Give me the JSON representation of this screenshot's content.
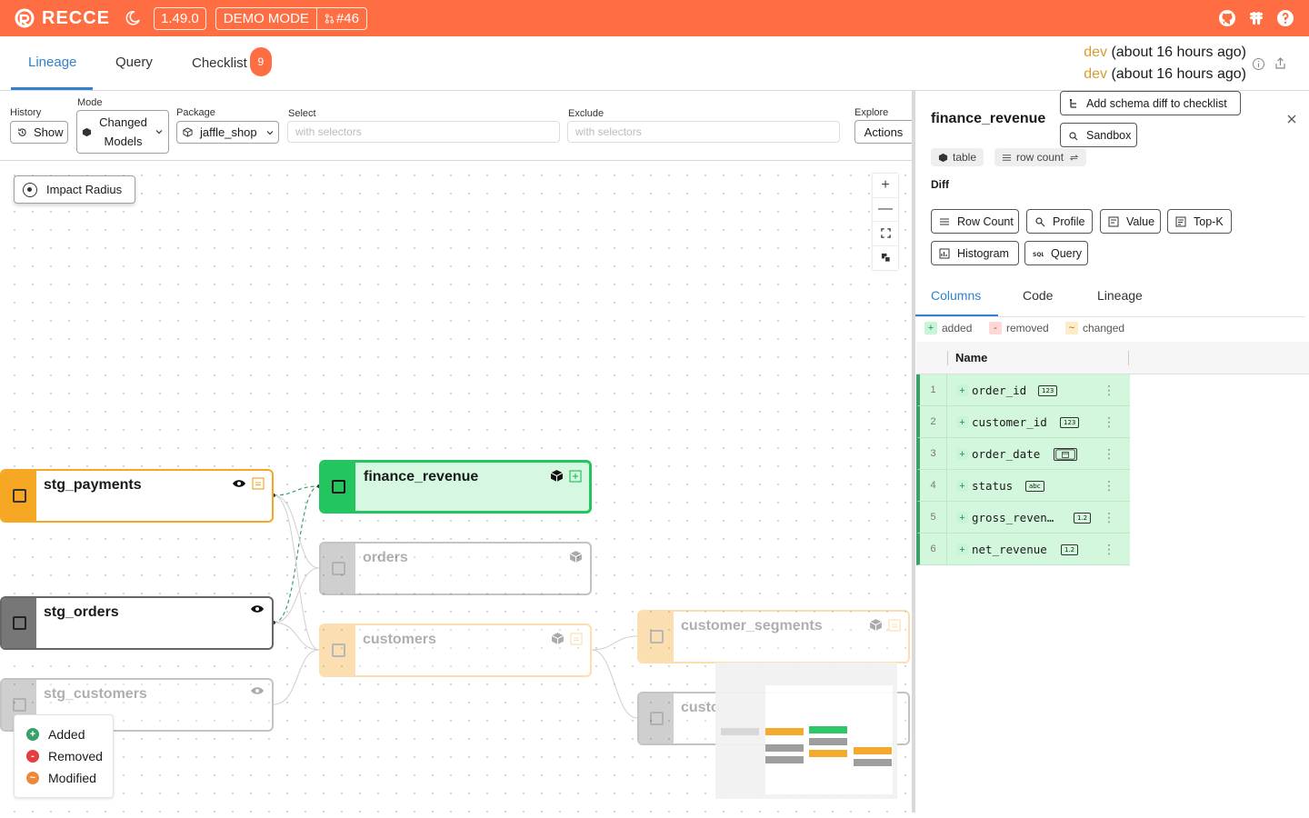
{
  "header": {
    "brand": "RECCE",
    "version": "1.49.0",
    "mode_badge": "DEMO MODE",
    "pr_number": "#46",
    "accent_color": "#ff6e42"
  },
  "tabs": [
    {
      "label": "Lineage",
      "active": true
    },
    {
      "label": "Query"
    },
    {
      "label": "Checklist",
      "badge": "9"
    }
  ],
  "env": {
    "base": {
      "name": "dev",
      "time": "(about 16 hours ago)"
    },
    "current": {
      "name": "dev",
      "time": "(about 16 hours ago)"
    }
  },
  "filters": {
    "history": {
      "label": "History",
      "button": "Show"
    },
    "mode": {
      "label": "Mode",
      "value_line1": "Changed",
      "value_line2": "Models"
    },
    "package": {
      "label": "Package",
      "value": "jaffle_shop"
    },
    "select": {
      "label": "Select",
      "placeholder": "with selectors"
    },
    "exclude": {
      "label": "Exclude",
      "placeholder": "with selectors"
    },
    "explore": {
      "label": "Explore",
      "button": "Actions"
    }
  },
  "canvas": {
    "impact_radius": "Impact Radius",
    "nodes": [
      {
        "name": "stg_payments",
        "status": "modified"
      },
      {
        "name": "finance_revenue",
        "status": "added",
        "selected": true
      },
      {
        "name": "orders",
        "status": "unchanged"
      },
      {
        "name": "stg_orders",
        "status": "unchanged"
      },
      {
        "name": "customers",
        "status": "modified"
      },
      {
        "name": "customer_segments",
        "status": "modified"
      },
      {
        "name": "stg_customers",
        "status": "unchanged"
      },
      {
        "name": "custo",
        "status": "unchanged"
      }
    ],
    "legend": [
      {
        "label": "Added",
        "symbol": "+",
        "color": "#38a169"
      },
      {
        "label": "Removed",
        "symbol": "-",
        "color": "#e53e3e"
      },
      {
        "label": "Modified",
        "symbol": "~",
        "color": "#ed8936"
      }
    ]
  },
  "panel": {
    "title": "finance_revenue",
    "add_schema_diff": "Add schema diff to checklist",
    "sandbox": "Sandbox",
    "tags": [
      "table",
      "row count"
    ],
    "diff_label": "Diff",
    "diff_buttons": [
      "Row Count",
      "Profile",
      "Value",
      "Top-K",
      "Histogram",
      "Query"
    ],
    "tabs": [
      "Columns",
      "Code",
      "Lineage"
    ],
    "legend": [
      "added",
      "removed",
      "changed"
    ],
    "grid_header": "Name",
    "columns": [
      {
        "idx": "1",
        "name": "order_id",
        "type": "123"
      },
      {
        "idx": "2",
        "name": "customer_id",
        "type": "123"
      },
      {
        "idx": "3",
        "name": "order_date",
        "type": "date"
      },
      {
        "idx": "4",
        "name": "status",
        "type": "abc"
      },
      {
        "idx": "5",
        "name": "gross_reven…",
        "type": "1.2"
      },
      {
        "idx": "6",
        "name": "net_revenue",
        "type": "1.2"
      }
    ]
  }
}
